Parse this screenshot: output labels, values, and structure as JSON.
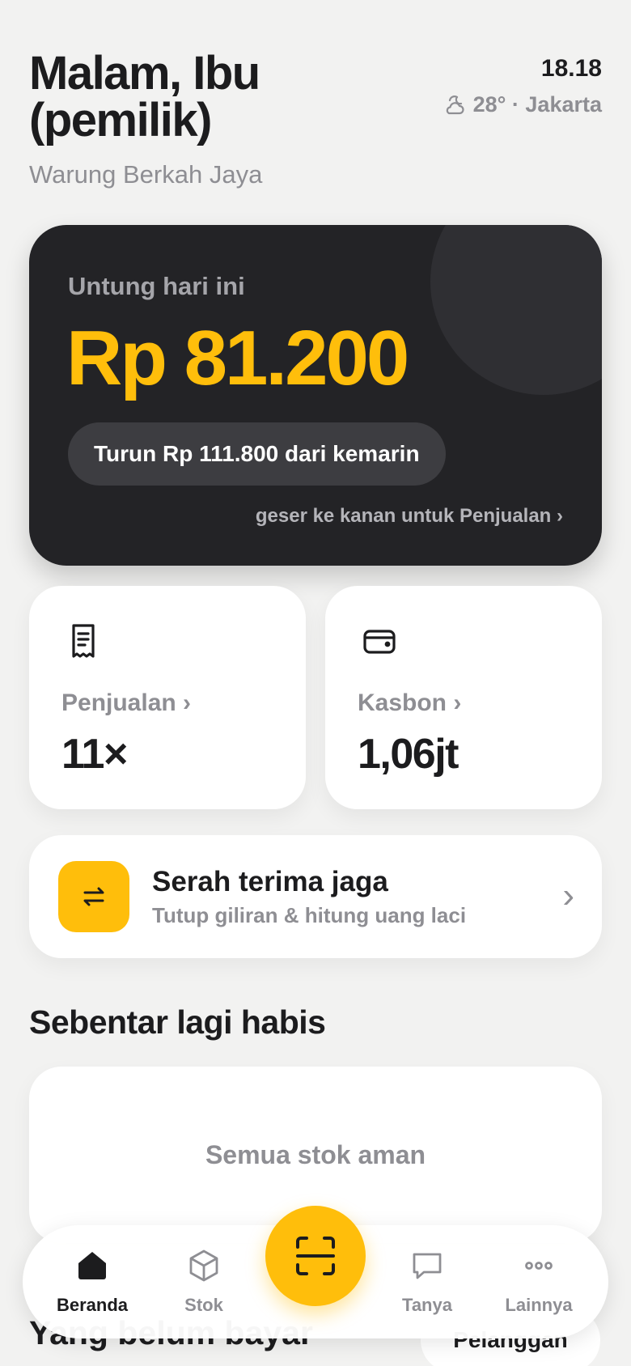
{
  "header": {
    "greeting": "Malam, Ibu (pemilik)",
    "store_name": "Warung Berkah Jaya",
    "time": "18.18",
    "weather": "28° · Jakarta"
  },
  "profit": {
    "label": "Untung hari ini",
    "value": "Rp 81.200",
    "delta": "Turun Rp 111.800 dari kemarin",
    "swipe_hint": "geser ke kanan untuk Penjualan ›"
  },
  "stats": {
    "sales": {
      "label": "Penjualan ›",
      "value": "11×",
      "icon": "receipt-icon"
    },
    "credit": {
      "label": "Kasbon ›",
      "value": "1,06jt",
      "icon": "wallet-icon"
    }
  },
  "shift": {
    "title": "Serah terima jaga",
    "subtitle": "Tutup giliran & hitung uang laci",
    "chevron": "›",
    "icon": "swap-arrows-icon"
  },
  "running_low": {
    "title": "Sebentar lagi habis",
    "empty_text": "Semua stok aman"
  },
  "unpaid": {
    "title": "Yang belum bayar",
    "button": "Pelanggan"
  },
  "nav": {
    "items": [
      {
        "label": "Beranda",
        "icon": "home-icon",
        "active": true
      },
      {
        "label": "Stok",
        "icon": "box-icon",
        "active": false
      },
      {
        "label": "Tanya",
        "icon": "chat-icon",
        "active": false
      },
      {
        "label": "Lainnya",
        "icon": "more-icon",
        "active": false
      }
    ],
    "scan_icon": "scan-icon"
  },
  "colors": {
    "accent": "#ffbe0b",
    "card_dark": "#232326",
    "background": "#f2f2f1",
    "muted_text": "#8e8e93"
  }
}
